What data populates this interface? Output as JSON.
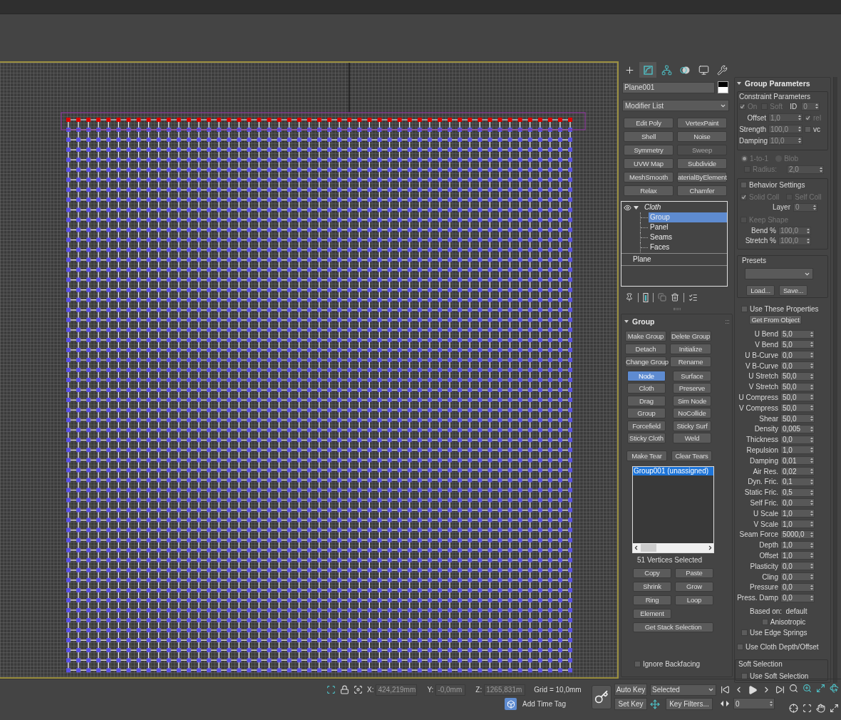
{
  "command_panel": {
    "tabs": [
      {
        "kind": "create",
        "selected": false
      },
      {
        "kind": "modify",
        "selected": true
      },
      {
        "kind": "hierarchy",
        "selected": false
      },
      {
        "kind": "motion",
        "selected": false
      },
      {
        "kind": "display",
        "selected": false
      },
      {
        "kind": "utilities",
        "selected": false
      }
    ],
    "object_name": "Plane001",
    "modifier_list": "Modifier List",
    "modifier_buttons": [
      {
        "label": "Edit Poly",
        "disabled": false
      },
      {
        "label": "VertexPaint",
        "disabled": false
      },
      {
        "label": "Shell",
        "disabled": false
      },
      {
        "label": "Noise",
        "disabled": false
      },
      {
        "label": "Symmetry",
        "disabled": false
      },
      {
        "label": "Sweep",
        "disabled": true
      },
      {
        "label": "UVW Map",
        "disabled": false
      },
      {
        "label": "Subdivide",
        "disabled": false
      },
      {
        "label": "MeshSmooth",
        "disabled": false
      },
      {
        "label": "aterialByElement",
        "disabled": false
      },
      {
        "label": "Relax",
        "disabled": false
      },
      {
        "label": "Chamfer",
        "disabled": false
      }
    ],
    "stack": [
      {
        "label": "Cloth",
        "visible": true,
        "expanded": true,
        "selected": false,
        "children": [
          {
            "label": "Group",
            "selected": true
          },
          {
            "label": "Panel",
            "selected": false
          },
          {
            "label": "Seams",
            "selected": false
          },
          {
            "label": "Faces",
            "selected": false
          }
        ]
      },
      {
        "label": "Plane",
        "selected": false
      }
    ]
  },
  "group_rollout": {
    "title": "Group",
    "expanded": true,
    "edit_buttons": [
      "Make Group",
      "Delete Group",
      "Detach",
      "Initialize",
      "Change Group",
      "Rename"
    ],
    "type_buttons": [
      {
        "label": "Node",
        "selected": true
      },
      {
        "label": "Surface",
        "selected": false
      },
      {
        "label": "Cloth",
        "selected": false
      },
      {
        "label": "Preserve",
        "selected": false
      },
      {
        "label": "Drag",
        "selected": false
      },
      {
        "label": "Sim Node",
        "selected": false
      },
      {
        "label": "Group",
        "selected": false
      },
      {
        "label": "NoCollide",
        "selected": false
      },
      {
        "label": "Forcefield",
        "selected": false
      },
      {
        "label": "Sticky Surf",
        "selected": false
      },
      {
        "label": "Sticky Cloth",
        "selected": false
      },
      {
        "label": "Weld",
        "selected": false
      }
    ],
    "tear_buttons": [
      "Make Tear",
      "Clear Tears"
    ],
    "groups": [
      {
        "label": "Group001 (unassigned)",
        "selected": true
      }
    ],
    "selection_count": "51 Vertices Selected",
    "selection_buttons": [
      "Copy",
      "Paste",
      "Shrink",
      "Grow",
      "Ring",
      "Loop",
      "Element"
    ],
    "stack_selection_button": "Get Stack Selection",
    "ignore_backfacing": {
      "label": "Ignore Backfacing",
      "checked": false
    }
  },
  "group_parameters": {
    "title": "Group Parameters",
    "expanded": true,
    "constraint": {
      "title": "Constraint Parameters",
      "on": {
        "label": "On",
        "checked": true,
        "disabled": true
      },
      "soft": {
        "label": "Soft",
        "checked": false,
        "disabled": true
      },
      "id": {
        "label": "ID",
        "value": "0",
        "disabled": true
      },
      "spinners": [
        {
          "label": "Offset",
          "value": "1,0",
          "disabled": true
        },
        {
          "label": "Strength",
          "value": "100,0",
          "disabled": true
        },
        {
          "label": "Damping",
          "value": "10,0",
          "disabled": true
        }
      ],
      "rel": {
        "label": "rel",
        "checked": true,
        "disabled": true
      },
      "vc": {
        "label": "vc",
        "checked": false,
        "disabled": false
      }
    },
    "mode_options": [
      {
        "label": "1-to-1",
        "selected": true,
        "disabled": true
      },
      {
        "label": "Blob",
        "selected": false,
        "disabled": true
      }
    ],
    "radius": {
      "label": "Radius:",
      "checked": false,
      "value": "2,0",
      "disabled": true
    },
    "behavior": {
      "label": "Behavior Settings",
      "checked": false,
      "solid_coll": {
        "label": "Solid Coll",
        "checked": true,
        "disabled": true
      },
      "self_coll": {
        "label": "Self Coll",
        "checked": false,
        "disabled": true
      },
      "layer": {
        "label": "Layer",
        "value": "0",
        "disabled": true
      },
      "keep_shape": {
        "label": "Keep Shape",
        "checked": false,
        "disabled": true
      },
      "spinners": [
        {
          "label": "Bend %",
          "value": "100,0",
          "disabled": true
        },
        {
          "label": "Stretch %",
          "value": "100,0",
          "disabled": true
        }
      ]
    },
    "presets": {
      "title": "Presets",
      "buttons": [
        "Load...",
        "Save..."
      ]
    },
    "use_these": {
      "label": "Use These Properties",
      "checked": false
    },
    "get_from_object": "Get From Object",
    "properties": [
      {
        "label": "U Bend",
        "value": "5,0"
      },
      {
        "label": "V Bend",
        "value": "5,0"
      },
      {
        "label": "U B-Curve",
        "value": "0,0"
      },
      {
        "label": "V B-Curve",
        "value": "0,0"
      },
      {
        "label": "U Stretch",
        "value": "50,0"
      },
      {
        "label": "V Stretch",
        "value": "50,0"
      },
      {
        "label": "U Compress",
        "value": "50,0"
      },
      {
        "label": "V Compress",
        "value": "50,0"
      },
      {
        "label": "Shear",
        "value": "50,0"
      },
      {
        "label": "Density",
        "value": "0,005"
      },
      {
        "label": "Thickness",
        "value": "0,0"
      },
      {
        "label": "Repulsion",
        "value": "1,0"
      },
      {
        "label": "Damping",
        "value": "0,01"
      },
      {
        "label": "Air Res.",
        "value": "0,02"
      },
      {
        "label": "Dyn. Fric.",
        "value": "0,1"
      },
      {
        "label": "Static Fric.",
        "value": "0,5"
      },
      {
        "label": "Self Fric.",
        "value": "0,0"
      },
      {
        "label": "U Scale",
        "value": "1,0"
      },
      {
        "label": "V Scale",
        "value": "1,0"
      },
      {
        "label": "Seam Force",
        "value": "5000,0"
      },
      {
        "label": "Depth",
        "value": "1,0"
      },
      {
        "label": "Offset",
        "value": "1,0"
      },
      {
        "label": "Plasticity",
        "value": "0,0"
      },
      {
        "label": "Cling",
        "value": "0,0"
      },
      {
        "label": "Pressure",
        "value": "0,0"
      },
      {
        "label": "Press. Damp",
        "value": "0,0"
      }
    ],
    "based_on": "Based on:  default",
    "options": [
      {
        "label": "Anisotropic",
        "checked": false
      },
      {
        "label": "Use Edge Springs",
        "checked": false
      },
      {
        "label": "Use Cloth Depth/Offset",
        "checked": false
      }
    ],
    "soft_selection": {
      "title": "Soft Selection",
      "use": {
        "label": "Use Soft Selection",
        "checked": false
      }
    }
  },
  "status_bar": {
    "coords": [
      {
        "label": "X:",
        "value": "424,219mm"
      },
      {
        "label": "Y:",
        "value": "-0,0mm"
      },
      {
        "label": "Z:",
        "value": "1265,831m"
      }
    ],
    "grid": "Grid = 10,0mm",
    "time_tag": "Add Time Tag",
    "auto_key": {
      "label": "Auto Key",
      "on": false
    },
    "set_key": "Set Key",
    "key_target": "Selected",
    "key_filters": "Key Filters...",
    "frame": "0"
  }
}
